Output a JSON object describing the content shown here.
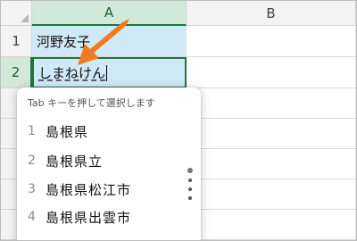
{
  "columns": [
    "A",
    "B"
  ],
  "rows": [
    "1",
    "2"
  ],
  "cells": {
    "a1": "河野友子",
    "a2": "しまねけん"
  },
  "ime": {
    "hint": "Tab キーを押して選択します",
    "candidates": [
      {
        "num": "1",
        "text": "島根県"
      },
      {
        "num": "2",
        "text": "島根県立"
      },
      {
        "num": "3",
        "text": "島根県松江市"
      },
      {
        "num": "4",
        "text": "島根県出雲市"
      }
    ]
  },
  "colors": {
    "excel_green": "#217346",
    "selection": "#cfe9f7",
    "arrow": "#f07a1e"
  },
  "icons": [
    "orange-arrow-icon",
    "candidate-scroll-dots-icon"
  ]
}
